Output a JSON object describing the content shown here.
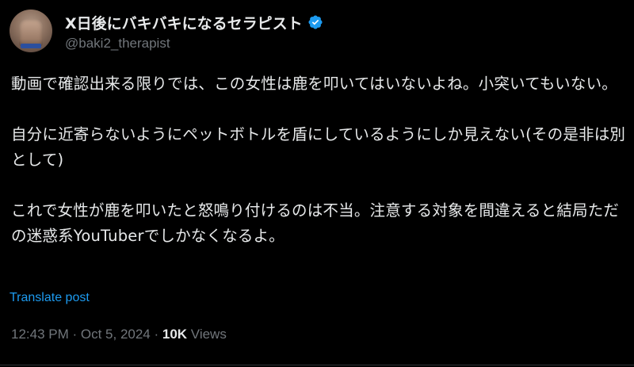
{
  "author": {
    "display_name": "X日後にバキバキになるセラピスト",
    "handle": "@baki2_therapist",
    "verified_icon": "verified-badge-icon",
    "avatar_icon": "avatar-photo"
  },
  "post": {
    "paragraphs": [
      "動画で確認出来る限りでは、この女性は鹿を叩いてはいないよね。小突いてもいない。",
      "自分に近寄らないようにペットボトルを盾にしているようにしか見えない(その是非は別として)",
      "これで女性が鹿を叩いたと怒鳴り付けるのは不当。注意する対象を間違えると結局ただの迷惑系YouTuberでしかなくなるよ。"
    ],
    "translate_label": "Translate post"
  },
  "meta": {
    "time": "12:43 PM",
    "separator1": " · ",
    "date": "Oct 5, 2024",
    "separator2": " · ",
    "views_count": "10K",
    "views_label": " Views"
  },
  "colors": {
    "background": "#000000",
    "text": "#e7e9ea",
    "secondary": "#71767b",
    "link": "#1d9bf0",
    "verified": "#1d9bf0"
  }
}
